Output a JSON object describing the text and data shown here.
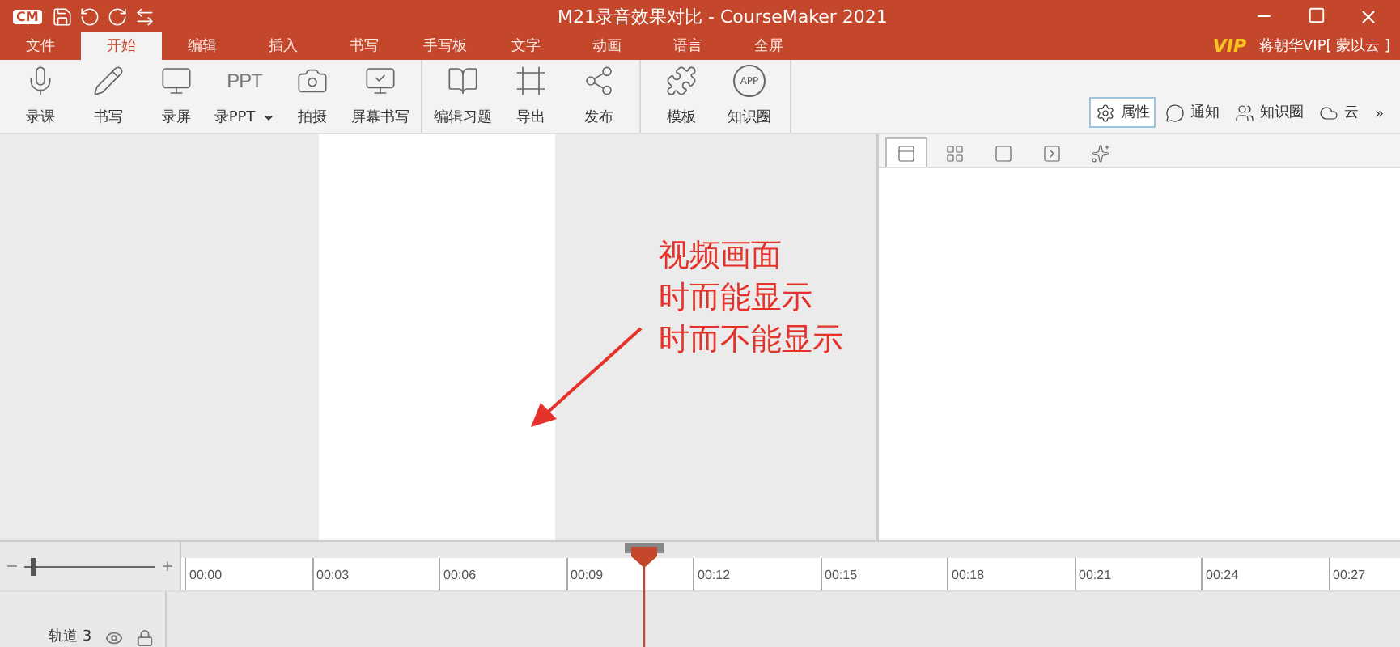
{
  "window": {
    "logo": "CM",
    "title": "M21录音效果对比 - CourseMaker 2021"
  },
  "menu_tabs": [
    {
      "label": "文件",
      "selected": false
    },
    {
      "label": "开始",
      "selected": true
    },
    {
      "label": "编辑",
      "selected": false
    },
    {
      "label": "插入",
      "selected": false
    },
    {
      "label": "书写",
      "selected": false
    },
    {
      "label": "手写板",
      "selected": false
    },
    {
      "label": "文字",
      "selected": false
    },
    {
      "label": "动画",
      "selected": false
    },
    {
      "label": "语言",
      "selected": false
    },
    {
      "label": "全屏",
      "selected": false
    }
  ],
  "account": {
    "vip": "VIP",
    "user": "蒋朝华VIP[ 蒙以云 ]"
  },
  "ribbon_groups": [
    [
      {
        "label": "录课",
        "kind": "icon"
      },
      {
        "label": "书写",
        "kind": "icon"
      },
      {
        "label": "录屏",
        "kind": "icon"
      },
      {
        "label": "录PPT",
        "kind": "text-mark",
        "mark": "PPT",
        "dropdown": true
      },
      {
        "label": "拍摄",
        "kind": "icon"
      },
      {
        "label": "屏幕书写",
        "kind": "icon"
      }
    ],
    [
      {
        "label": "编辑习题",
        "kind": "icon"
      },
      {
        "label": "导出",
        "kind": "icon"
      },
      {
        "label": "发布",
        "kind": "icon"
      }
    ],
    [
      {
        "label": "模板",
        "kind": "icon"
      },
      {
        "label": "知识圈",
        "kind": "circle-mark",
        "mark": "APP"
      }
    ]
  ],
  "side_tabs": [
    {
      "label": "属性",
      "selected": true
    },
    {
      "label": "通知",
      "selected": false
    },
    {
      "label": "知识圈",
      "selected": false
    },
    {
      "label": "云",
      "selected": false
    }
  ],
  "more": "»",
  "panel_tabs": [
    {
      "selected": true
    },
    {
      "selected": false
    },
    {
      "selected": false
    },
    {
      "selected": false
    },
    {
      "selected": false
    }
  ],
  "annotation": {
    "lines": [
      "视频画面",
      "时而能显示",
      "时而不能显示"
    ]
  },
  "timeline": {
    "zoom_minus": "−",
    "zoom_plus": "+",
    "zoom": {
      "level": 0.05
    },
    "ticks": [
      "00:00",
      "00:03",
      "00:06",
      "00:09",
      "00:12",
      "00:15",
      "00:18",
      "00:21",
      "00:24",
      "00:27"
    ],
    "tracks": [
      {
        "name": "轨道 3"
      }
    ]
  }
}
